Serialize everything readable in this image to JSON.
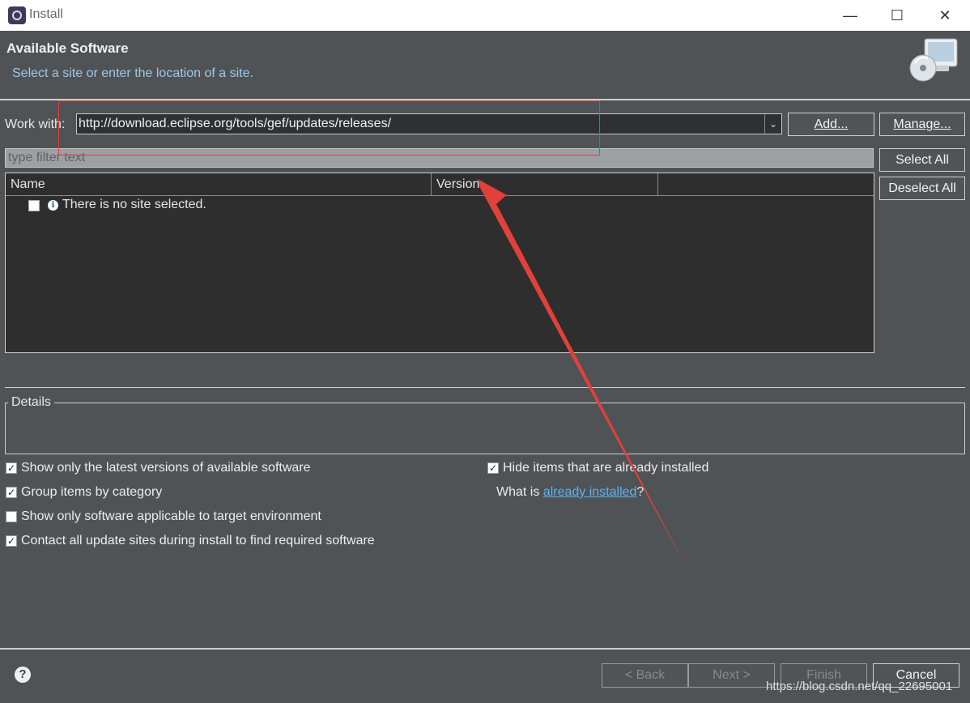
{
  "window": {
    "title": "Install",
    "minimize": "—",
    "maximize": "☐",
    "close": "✕"
  },
  "header": {
    "title": "Available Software",
    "subtitle": "Select a site or enter the location of a site."
  },
  "work_with": {
    "label": "Work with:",
    "value": "http://download.eclipse.org/tools/gef/updates/releases/",
    "add_button": "Add...",
    "manage_button": "Manage..."
  },
  "filter": {
    "placeholder": "type filter text"
  },
  "selection": {
    "select_all": "Select All",
    "deselect_all": "Deselect All"
  },
  "table": {
    "columns": [
      "Name",
      "Version",
      ""
    ],
    "message": "There is no site selected."
  },
  "details": {
    "label": "Details"
  },
  "options": {
    "latest_versions": {
      "label": "Show only the latest versions of available software",
      "checked": true
    },
    "group_by_category": {
      "label": "Group items by category",
      "checked": true
    },
    "target_env": {
      "label": "Show only software applicable to target environment",
      "checked": false
    },
    "contact_sites": {
      "label": "Contact all update sites during install to find required software",
      "checked": true
    },
    "hide_installed": {
      "label": "Hide items that are already installed",
      "checked": true
    },
    "what_is_prefix": "What is ",
    "what_is_link": "already installed",
    "what_is_suffix": "?"
  },
  "footer": {
    "back": "< Back",
    "next": "Next >",
    "finish": "Finish",
    "cancel": "Cancel"
  },
  "watermark": "https://blog.csdn.net/qq_22695001",
  "colors": {
    "background": "#4f5355",
    "table_bg": "#2e2e2e",
    "annotation": "#e2403a",
    "link": "#5fb3f0"
  }
}
